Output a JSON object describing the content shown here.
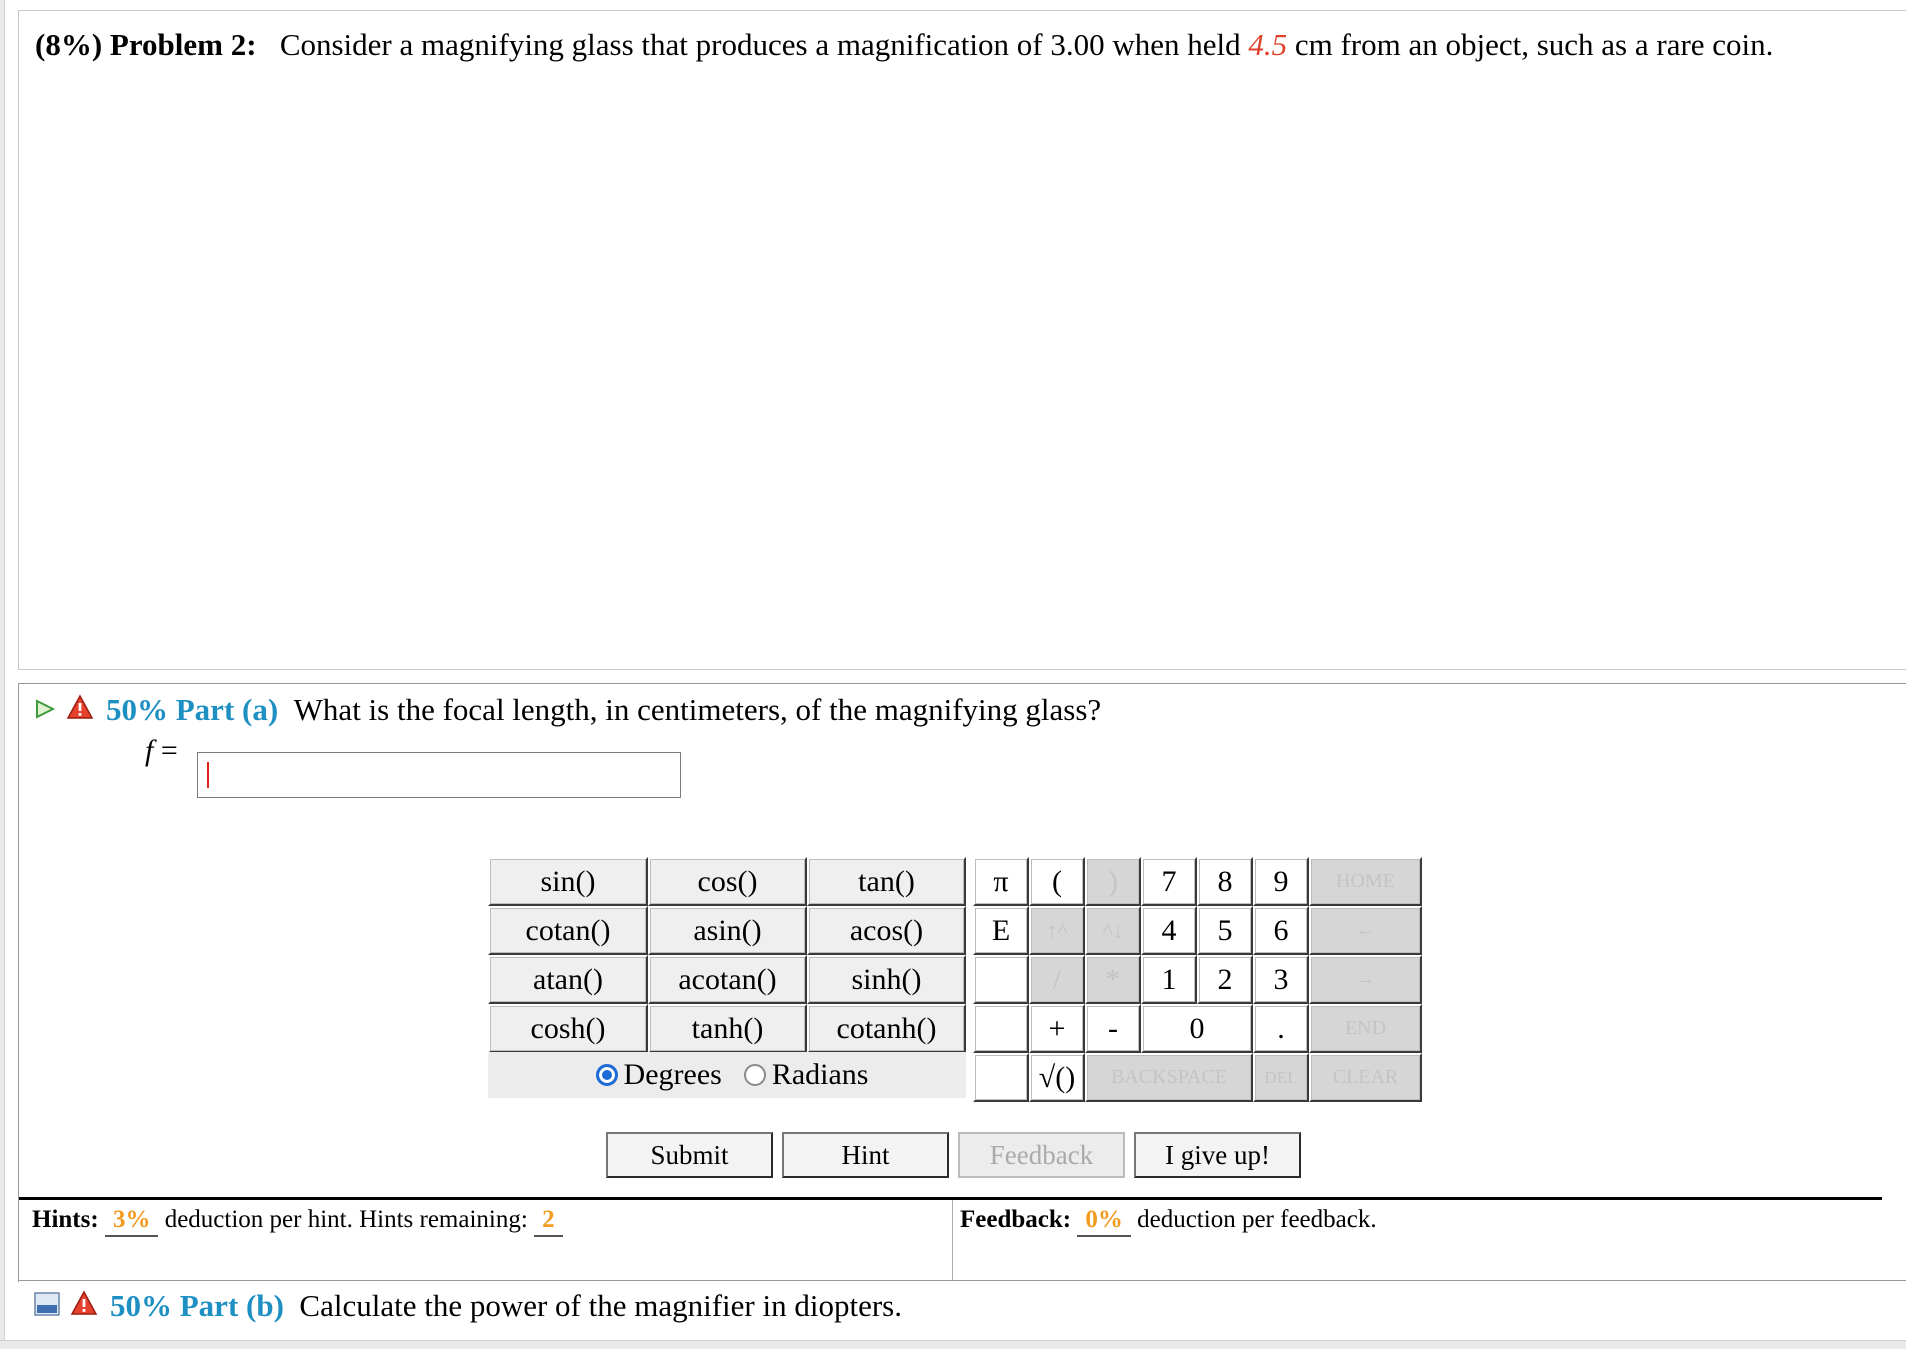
{
  "problem": {
    "percent": "(8%)",
    "label": "Problem 2:",
    "text_before": "Consider a magnifying glass that produces a magnification of 3.00 when held ",
    "variable": "4.5",
    "text_after": " cm from an object, such as a rare coin."
  },
  "part_a": {
    "percent": "50%",
    "label": "Part (a)",
    "question": "What is the focal length, in centimeters, of the magnifying glass?",
    "answer_label": "f",
    "answer_eq": " = ",
    "answer_value": ""
  },
  "calculator": {
    "functions": [
      [
        "sin()",
        "cos()",
        "tan()"
      ],
      [
        "cotan()",
        "asin()",
        "acos()"
      ],
      [
        "atan()",
        "acotan()",
        "sinh()"
      ],
      [
        "cosh()",
        "tanh()",
        "cotanh()"
      ]
    ],
    "symbols": {
      "pi": "π",
      "open_paren": "(",
      "close_paren": ")",
      "e": "E",
      "up_caret": "↑^",
      "down_caret": "^↓",
      "divide": "/",
      "multiply": "*",
      "plus": "+",
      "minus": "-",
      "sqrt": "√()",
      "dot": ".",
      "zero": "0"
    },
    "digits": [
      [
        "7",
        "8",
        "9"
      ],
      [
        "4",
        "5",
        "6"
      ],
      [
        "1",
        "2",
        "3"
      ]
    ],
    "nav": {
      "home": "HOME",
      "left": "←",
      "right": "→",
      "end": "END",
      "backspace": "BACKSPACE",
      "del": "DEL",
      "clear": "CLEAR"
    },
    "angle_mode": {
      "degrees": "Degrees",
      "radians": "Radians",
      "selected": "Degrees"
    }
  },
  "buttons": {
    "submit": "Submit",
    "hint": "Hint",
    "feedback": "Feedback",
    "give_up": "I give up!"
  },
  "hints": {
    "label": "Hints:",
    "deduction": "3%",
    "text1": " deduction per hint. Hints remaining: ",
    "remaining": "2"
  },
  "feedback": {
    "label": "Feedback:",
    "deduction": "0%",
    "text": " deduction per feedback."
  },
  "part_b": {
    "percent": "50%",
    "label": "Part (b)",
    "question": "Calculate the power of the magnifier in diopters."
  }
}
